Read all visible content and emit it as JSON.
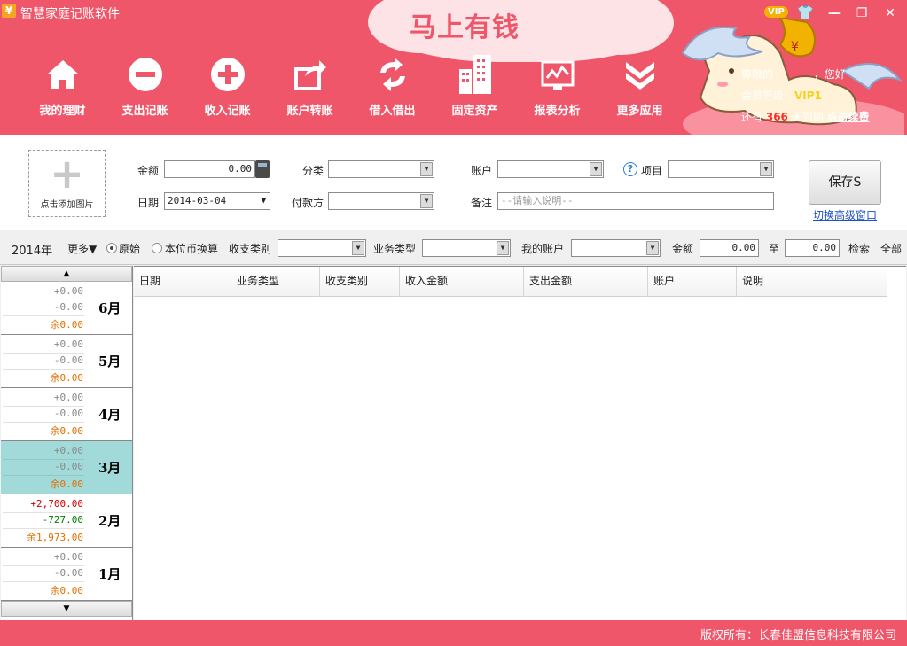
{
  "app": {
    "title": "智慧家庭记账软件",
    "icon_glyph": "¥",
    "slogan": "马上有钱",
    "vip_badge": "VIP"
  },
  "window": {
    "minimize": "—",
    "maximize": "❐",
    "close": "✕"
  },
  "nav": [
    {
      "label": "我的理财",
      "icon": "home-icon"
    },
    {
      "label": "支出记账",
      "icon": "minus-icon"
    },
    {
      "label": "收入记账",
      "icon": "plus-icon"
    },
    {
      "label": "账户转账",
      "icon": "transfer-icon"
    },
    {
      "label": "借入借出",
      "icon": "refresh-icon"
    },
    {
      "label": "固定资产",
      "icon": "building-icon"
    },
    {
      "label": "报表分析",
      "icon": "chart-icon"
    },
    {
      "label": "更多应用",
      "icon": "chevron-down-icon"
    }
  ],
  "user": {
    "greeting_prefix": "尊敬的",
    "greeting_suffix": "，您好",
    "level_prefix": "会员等级：",
    "level": "VIP1",
    "remain_prefix": "还有",
    "remain_days": "366",
    "remain_suffix": "天到期",
    "renew": "点击续费"
  },
  "form": {
    "add_image": "点击添加图片",
    "amount_label": "金额",
    "amount_value": "0.00",
    "category_label": "分类",
    "account_label": "账户",
    "project_label": "项目",
    "date_label": "日期",
    "date_value": "2014-03-04",
    "payer_label": "付款方",
    "note_label": "备注",
    "note_placeholder": "--请输入说明--",
    "save": "保存S",
    "advanced": "切换高级窗口"
  },
  "filter": {
    "year": "2014年",
    "more": "更多▼",
    "original": "原始",
    "convert": "本位币换算",
    "category_label": "收支类别",
    "biz_label": "业务类型",
    "account_label": "我的账户",
    "amount_label": "金额",
    "amount_from": "0.00",
    "to_label": "至",
    "amount_to": "0.00",
    "search": "检索",
    "all": "全部"
  },
  "months": [
    {
      "name": "6月",
      "income": "+0.00",
      "expense": "-0.00",
      "balance": "余0.00"
    },
    {
      "name": "5月",
      "income": "+0.00",
      "expense": "-0.00",
      "balance": "余0.00"
    },
    {
      "name": "4月",
      "income": "+0.00",
      "expense": "-0.00",
      "balance": "余0.00"
    },
    {
      "name": "3月",
      "income": "+0.00",
      "expense": "-0.00",
      "balance": "余0.00",
      "selected": true
    },
    {
      "name": "2月",
      "income": "+2,700.00",
      "expense": "-727.00",
      "balance": "余1,973.00"
    },
    {
      "name": "1月",
      "income": "+0.00",
      "expense": "-0.00",
      "balance": "余0.00"
    }
  ],
  "table": {
    "columns": [
      "日期",
      "业务类型",
      "收支类别",
      "收入金额",
      "支出金额",
      "账户",
      "说明"
    ]
  },
  "footer": {
    "copyright": "版权所有：长春佳盟信息科技有限公司"
  },
  "colors": {
    "brand": "#f0566a",
    "selected_month": "#a2dada",
    "balance": "#e07000"
  }
}
